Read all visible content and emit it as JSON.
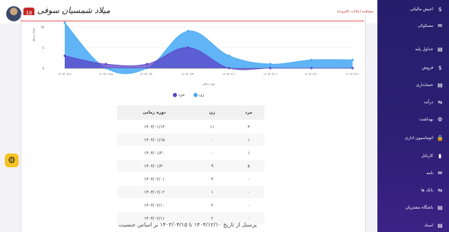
{
  "topbar": {
    "user_name": "میلاد شمسیان سوفی",
    "notifications": "18",
    "top_note": "مشاهده اعلانات (افزوده)",
    "pills": [
      "#e4e7ff",
      "#e5f4e2",
      "#e9e6f5"
    ]
  },
  "sidebar": {
    "items": [
      {
        "label": "اجیش مالیاتی",
        "icon": "$"
      },
      {
        "label": "مسکوکی",
        "icon": "✉"
      },
      {
        "label": "جداول پایه",
        "icon": "▤"
      },
      {
        "label": "فروش",
        "icon": "$"
      },
      {
        "label": "حسابداری",
        "icon": "▤"
      },
      {
        "label": "درآمد",
        "icon": "⇋"
      },
      {
        "label": "بهداشت",
        "icon": "⚙"
      },
      {
        "label": "اتوماسیون اداری",
        "icon": "🔒"
      },
      {
        "label": "کارتابل",
        "icon": "▮"
      },
      {
        "label": "نامه",
        "icon": "✉"
      },
      {
        "label": "بانک ها",
        "icon": "⇋"
      },
      {
        "label": "باشگاه مشتریان",
        "icon": "▤"
      },
      {
        "label": "اسناد",
        "icon": "▤"
      }
    ]
  },
  "chart_data": {
    "type": "area",
    "x": [
      "۱۴۰۳/۰۱/۱۴",
      "۱۴۰۳/۰۱/۱۵",
      "۱۴۰۳/۰۱/۲۰",
      "۱۴۰۳/۰۱/۳۰",
      "۱۴۰۳/۰۲/۰۱",
      "۱۴۰۳/۰۲/۰۲",
      "۱۴۰۳/۰۲/۱۰",
      "۱۴۰۳/۰۲/۱۱"
    ],
    "series": [
      {
        "name": "زن",
        "color": "#45a8f4",
        "values": [
          11,
          0,
          0,
          9,
          3,
          1,
          2,
          2
        ]
      },
      {
        "name": "مرد",
        "color": "#5b43c8",
        "values": [
          3,
          1,
          1,
          5,
          0,
          0,
          0,
          0
        ]
      }
    ],
    "y_ticks": [
      "0",
      "5",
      "10"
    ],
    "xlabel": "دوره زمانی",
    "ylabel": "تعداد پرسنل",
    "ylim": [
      0,
      11
    ],
    "grid": true,
    "legend": "bottom"
  },
  "table": {
    "headers": [
      "مرد",
      "زن",
      "دوره زمانی"
    ],
    "rows": [
      [
        "۳",
        "۱۱",
        "۱۴۰۳/۰۱/۱۴"
      ],
      [
        "۱",
        "۰",
        "۱۴۰۳/۰۱/۱۵"
      ],
      [
        "۱",
        "۰",
        "۱۴۰۳/۰۱/۲۰"
      ],
      [
        "۵",
        "۹",
        "۱۴۰۳/۰۱/۳۰"
      ],
      [
        "۰",
        "۳",
        "۱۴۰۳/۰۲/۰۱"
      ],
      [
        "۰",
        "۱",
        "۱۴۰۳/۰۲/۰۲"
      ],
      [
        "۰",
        "۲",
        "۱۴۰۳/۰۲/۱۰"
      ],
      [
        "۰",
        "۲",
        "۱۴۰۳/۰۲/۱۱"
      ]
    ]
  },
  "caption": "پرسنل از تاریخ ۱۴۰۴/۱۲/۱۰ تا ۱۴۰۳/۰۴/۱۵ بر اساس جنسیت"
}
